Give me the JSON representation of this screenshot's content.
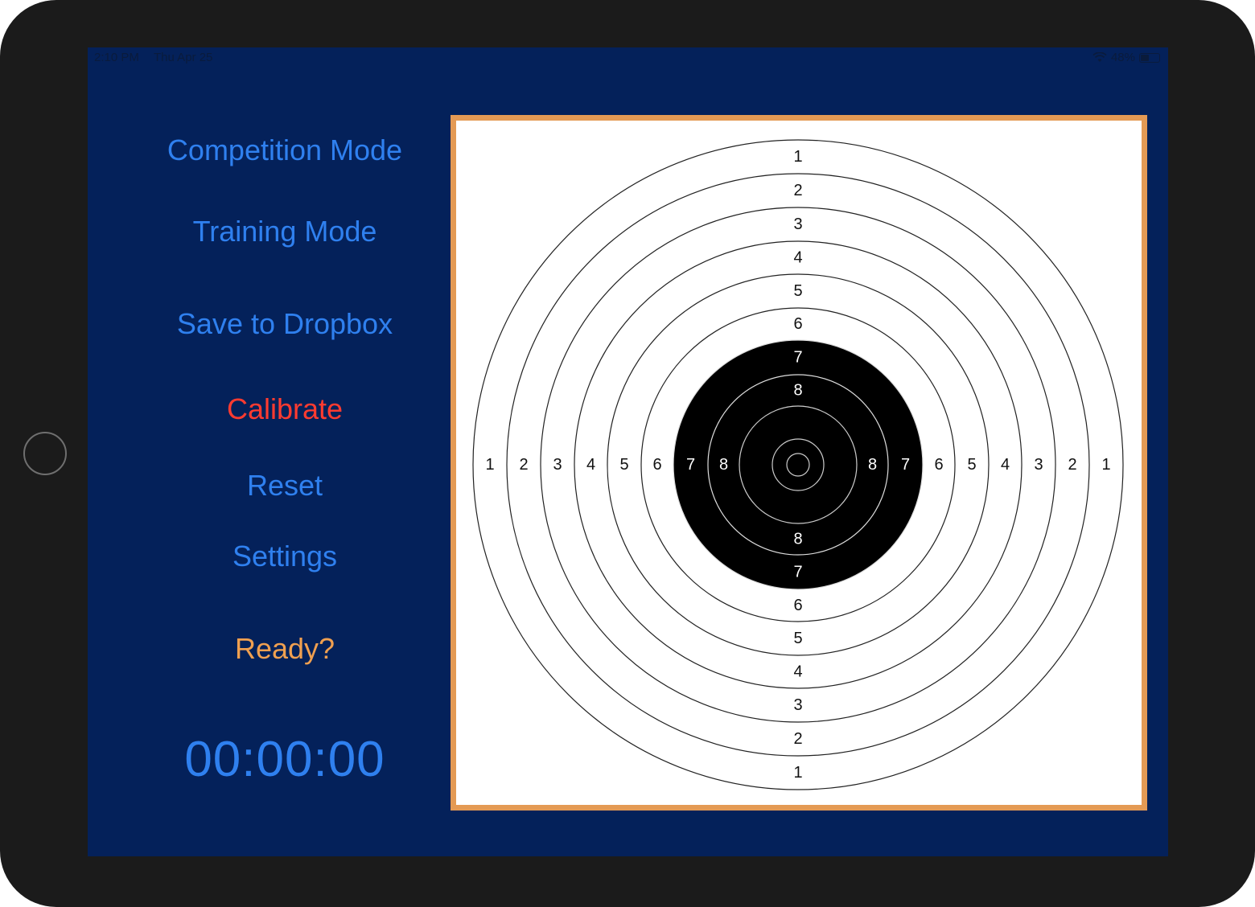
{
  "status_bar": {
    "time": "2:10 PM",
    "date": "Thu Apr 25",
    "battery_percent": "48%",
    "battery_level": 0.48,
    "wifi_icon": "wifi-icon"
  },
  "menu": {
    "competition": "Competition Mode",
    "training": "Training Mode",
    "dropbox": "Save to Dropbox",
    "calibrate": "Calibrate",
    "reset": "Reset",
    "settings": "Settings",
    "ready": "Ready?"
  },
  "timer": "00:00:00",
  "target": {
    "rings": [
      "1",
      "2",
      "3",
      "4",
      "5",
      "6",
      "7",
      "8"
    ],
    "top_labels": [
      "1",
      "2",
      "3",
      "4",
      "5",
      "6",
      "7",
      "8"
    ],
    "bottom_labels": [
      "8",
      "7",
      "6",
      "5",
      "4",
      "3",
      "2",
      "1"
    ],
    "left_labels": [
      "1",
      "2",
      "3",
      "4",
      "5",
      "6",
      "7",
      "8"
    ],
    "right_labels": [
      "8",
      "7",
      "6",
      "5",
      "4",
      "3",
      "2",
      "1"
    ]
  },
  "colors": {
    "screen_bg": "#04215a",
    "link_blue": "#2f80ef",
    "calibrate_red": "#ff3b30",
    "ready_orange": "#f0a050",
    "frame_orange": "#e49a54"
  }
}
